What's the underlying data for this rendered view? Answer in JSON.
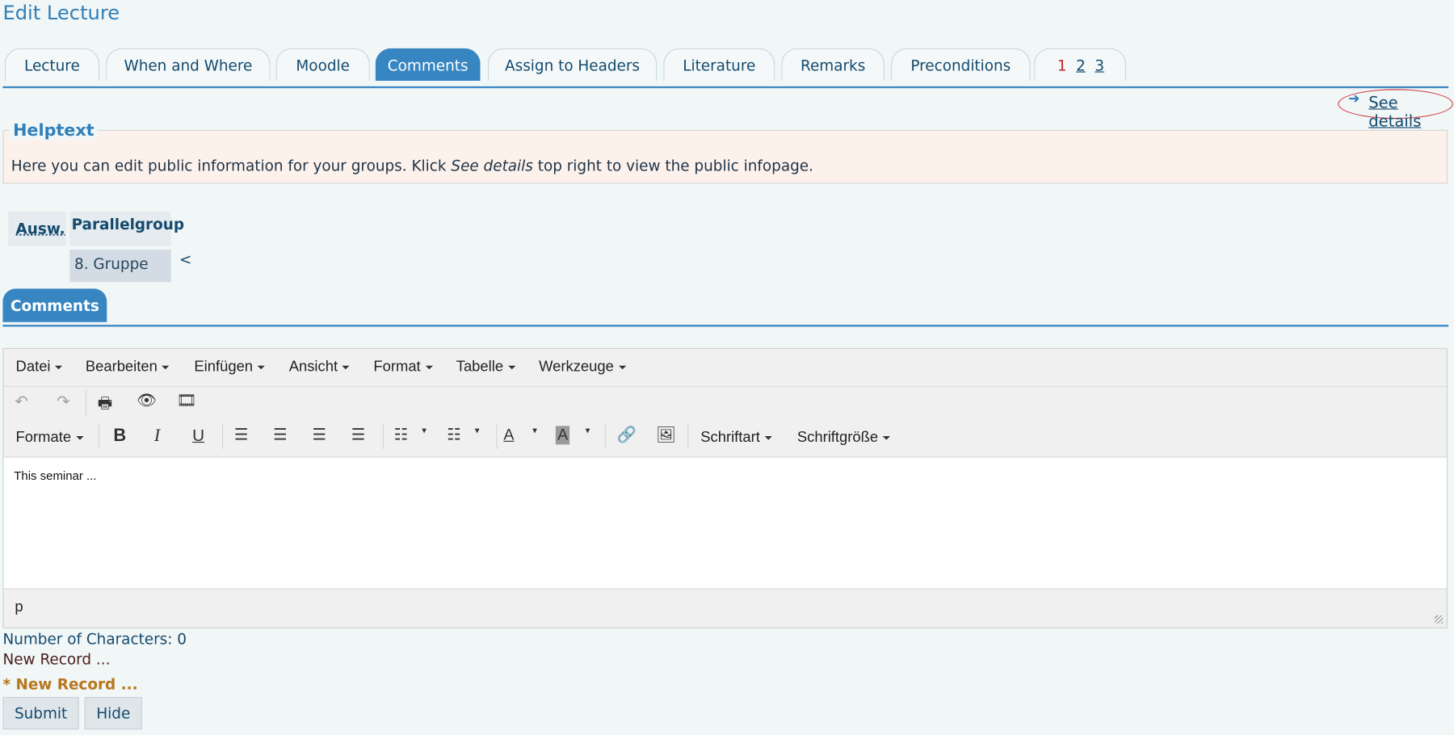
{
  "page_title": "Edit Lecture",
  "tabs": [
    {
      "label": "Lecture"
    },
    {
      "label": "When and Where"
    },
    {
      "label": "Moodle"
    },
    {
      "label": "Comments"
    },
    {
      "label": "Assign to Headers"
    },
    {
      "label": "Literature"
    },
    {
      "label": "Remarks"
    },
    {
      "label": "Preconditions"
    }
  ],
  "pager": [
    "1",
    "2",
    "3"
  ],
  "see_details": "See details",
  "helptext": {
    "legend": "Helptext",
    "before": "Here you can edit public information for your groups. Klick ",
    "emph": "See details",
    "after": " top right to view the public infopage."
  },
  "groups": {
    "col_select": "Ausw.",
    "col_group": "Parallelgroup",
    "row_group": "8. Gruppe",
    "indicator": "<"
  },
  "comments_tab": "Comments",
  "editor": {
    "menus": [
      "Datei",
      "Bearbeiten",
      "Einfügen",
      "Ansicht",
      "Format",
      "Tabelle",
      "Werkzeuge"
    ],
    "formats_label": "Formate",
    "font_label": "Schriftart",
    "fontsize_label": "Schriftgröße",
    "content": "This seminar ...",
    "status_path": "p"
  },
  "char_count": "Number of Characters: 0",
  "new_record": "New Record ...",
  "new_record_required": "* New Record ...",
  "buttons": {
    "submit": "Submit",
    "hide": "Hide"
  }
}
